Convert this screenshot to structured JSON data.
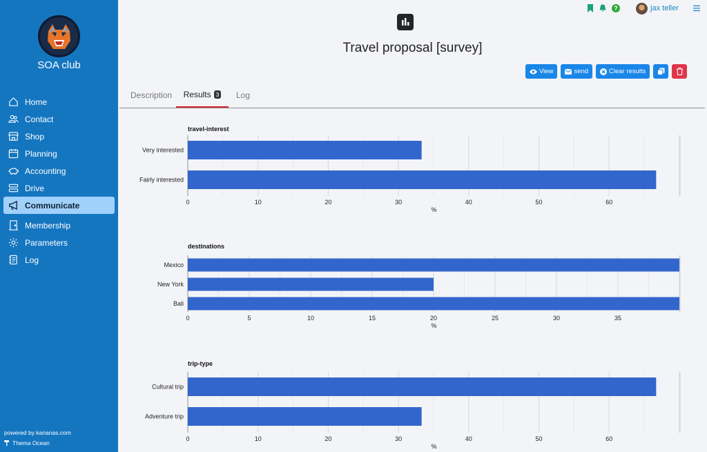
{
  "sidebar": {
    "club_name": "SOA club",
    "items": [
      {
        "label": "Home",
        "icon": "home-icon"
      },
      {
        "label": "Contact",
        "icon": "users-icon"
      },
      {
        "label": "Shop",
        "icon": "shop-icon"
      },
      {
        "label": "Planning",
        "icon": "calendar-icon"
      },
      {
        "label": "Accounting",
        "icon": "piggy-bank-icon"
      },
      {
        "label": "Drive",
        "icon": "drive-icon"
      },
      {
        "label": "Communicate",
        "icon": "megaphone-icon",
        "active": true
      },
      {
        "label": "Membership",
        "icon": "door-icon"
      },
      {
        "label": "Parameters",
        "icon": "gear-icon"
      },
      {
        "label": "Log",
        "icon": "journal-icon"
      }
    ],
    "powered_by": "powered by kananas.com",
    "theme": "Thema Ocean"
  },
  "topbar": {
    "user_name": "jax teller",
    "help_label": "?"
  },
  "header": {
    "title": "Travel proposal [survey]"
  },
  "actions": {
    "view_label": "View",
    "send_label": "send",
    "clear_label": "Clear results"
  },
  "tabs": [
    {
      "label": "Description",
      "active": false
    },
    {
      "label": "Results",
      "badge": "3",
      "active": true
    },
    {
      "label": "Log",
      "active": false
    }
  ],
  "colors": {
    "sidebar_bg": "#1576c0",
    "bar": "#3366cc",
    "button": "#1a86e8",
    "danger": "#e0364a",
    "tab_active_underline": "#d9232d"
  },
  "chart_data": [
    {
      "type": "bar",
      "orientation": "horizontal",
      "title": "travel-interest",
      "categories": [
        "Very interested",
        "Fairly interested"
      ],
      "values": [
        33.3,
        66.7
      ],
      "xlabel": "%",
      "xlim": [
        0,
        70
      ],
      "ticks": [
        0,
        10,
        20,
        30,
        40,
        50,
        60
      ],
      "grid": true
    },
    {
      "type": "bar",
      "orientation": "horizontal",
      "title": "destinations",
      "categories": [
        "Mexico",
        "New York",
        "Bali"
      ],
      "values": [
        40,
        20,
        40
      ],
      "xlabel": "%",
      "xlim": [
        0,
        40
      ],
      "ticks": [
        0,
        5,
        10,
        15,
        20,
        25,
        30,
        35
      ],
      "grid": true
    },
    {
      "type": "bar",
      "orientation": "horizontal",
      "title": "trip-type",
      "categories": [
        "Cultural trip",
        "Adventure trip"
      ],
      "values": [
        66.7,
        33.3
      ],
      "xlabel": "%",
      "xlim": [
        0,
        70
      ],
      "ticks": [
        0,
        10,
        20,
        30,
        40,
        50,
        60
      ],
      "grid": true
    }
  ]
}
